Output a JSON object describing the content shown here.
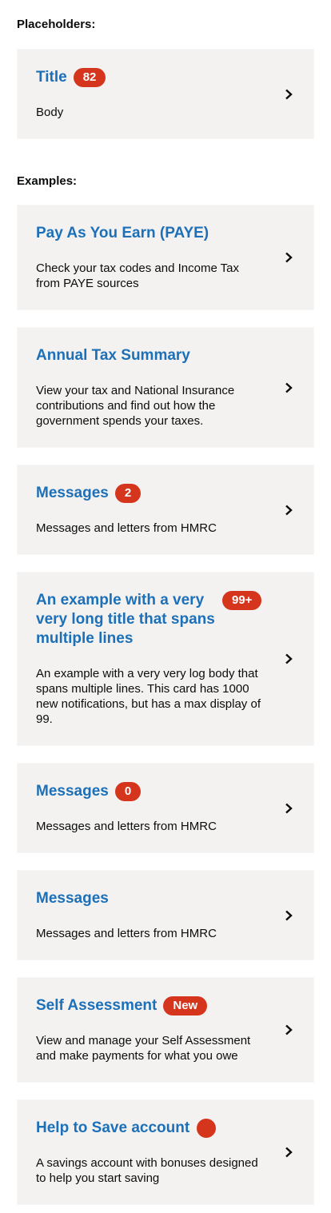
{
  "placeholders_heading": "Placeholders:",
  "examples_heading": "Examples:",
  "placeholder_card": {
    "title": "Title",
    "badge": "82",
    "body": "Body"
  },
  "cards": [
    {
      "title": "Pay As You Earn (PAYE)",
      "body": "Check your tax codes and Income Tax from PAYE sources"
    },
    {
      "title": "Annual Tax Summary",
      "body": "View your tax and National Insurance contributions and find out how the government spends your taxes."
    },
    {
      "title": "Messages",
      "badge": "2",
      "body": "Messages and letters from HMRC"
    },
    {
      "title": "An example with a very very long title that spans multiple lines",
      "badge": "99+",
      "body": "An example with a very very log body that spans multiple lines. This card has 1000 new notifications, but has a max display of 99."
    },
    {
      "title": "Messages",
      "badge": "0",
      "body": "Messages and letters from HMRC"
    },
    {
      "title": "Messages",
      "body": "Messages and letters from HMRC"
    },
    {
      "title": "Self Assessment",
      "badge": "New",
      "body": "View and manage your Self Assessment and make payments for what you owe"
    },
    {
      "title": "Help to Save account",
      "dot": true,
      "body": "A savings account with bonuses designed to help you start saving"
    }
  ],
  "colors": {
    "title": "#1d70b8",
    "badge": "#d4351c",
    "card": "#f3f2f1"
  }
}
